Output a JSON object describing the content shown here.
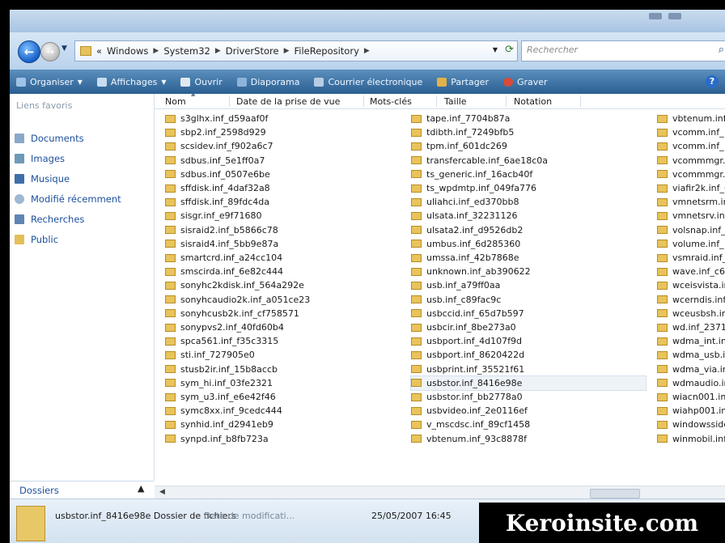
{
  "breadcrumb": {
    "overflow": "«",
    "segments": [
      "Windows",
      "System32",
      "DriverStore",
      "FileRepository"
    ]
  },
  "search": {
    "placeholder": "Rechercher"
  },
  "toolbar": {
    "organiser": "Organiser",
    "affichages": "Affichages",
    "ouvrir": "Ouvrir",
    "diaporama": "Diaporama",
    "courrier": "Courrier électronique",
    "partager": "Partager",
    "graver": "Graver"
  },
  "nav": {
    "header": "Liens favoris",
    "items": [
      "Documents",
      "Images",
      "Musique",
      "Modifié récemment",
      "Recherches",
      "Public"
    ],
    "dossiers": "Dossiers"
  },
  "columns": [
    "Nom",
    "Date de la prise de vue",
    "Mots-clés",
    "Taille",
    "Notation"
  ],
  "files": {
    "col1": [
      "s3glhx.inf_d59aaf0f",
      "sbp2.inf_2598d929",
      "scsidev.inf_f902a6c7",
      "sdbus.inf_5e1ff0a7",
      "sdbus.inf_0507e6be",
      "sffdisk.inf_4daf32a8",
      "sffdisk.inf_89fdc4da",
      "sisgr.inf_e9f71680",
      "sisraid2.inf_b5866c78",
      "sisraid4.inf_5bb9e87a",
      "smartcrd.inf_a24cc104",
      "smscirda.inf_6e82c444",
      "sonyhc2kdisk.inf_564a292e",
      "sonyhcaudio2k.inf_a051ce23",
      "sonyhcusb2k.inf_cf758571",
      "sonypvs2.inf_40fd60b4",
      "spca561.inf_f35c3315",
      "sti.inf_727905e0",
      "stusb2ir.inf_15b8accb",
      "sym_hi.inf_03fe2321",
      "sym_u3.inf_e6e42f46",
      "symc8xx.inf_9cedc444",
      "synhid.inf_d2941eb9",
      "synpd.inf_b8fb723a"
    ],
    "col2": [
      "tape.inf_7704b87a",
      "tdibth.inf_7249bfb5",
      "tpm.inf_601dc269",
      "transfercable.inf_6ae18c0a",
      "ts_generic.inf_16acb40f",
      "ts_wpdmtp.inf_049fa776",
      "uliahci.inf_ed370bb8",
      "ulsata.inf_32231126",
      "ulsata2.inf_d9526db2",
      "umbus.inf_6d285360",
      "umssa.inf_42b7868e",
      "unknown.inf_ab390622",
      "usb.inf_a79ff0aa",
      "usb.inf_c89fac9c",
      "usbccid.inf_65d7b597",
      "usbcir.inf_8be273a0",
      "usbport.inf_4d107f9d",
      "usbport.inf_8620422d",
      "usbprint.inf_35521f61",
      "usbstor.inf_8416e98e",
      "usbstor.inf_bb2778a0",
      "usbvideo.inf_2e0116ef",
      "v_mscdsc.inf_89cf1458",
      "vbtenum.inf_93c8878f"
    ],
    "col3": [
      "vbtenum.inf",
      "vcomm.inf_",
      "vcomm.inf_",
      "vcommmgr.",
      "vcommmgr.",
      "viafir2k.inf_6",
      "vmnetsrm.in",
      "vmnetsrv.inf",
      "volsnap.inf_",
      "volume.inf_",
      "vsmraid.inf_",
      "wave.inf_c65",
      "wceisvista.in",
      "wcerndis.inf",
      "wceusbsh.in",
      "wd.inf_2371f",
      "wdma_int.in",
      "wdma_usb.i",
      "wdma_via.in",
      "wdmaudio.ir",
      "wiacn001.inf",
      "wiahp001.inf",
      "windowsside",
      "winmobil.inf"
    ]
  },
  "status": {
    "name": "usbstor.inf_8416e98e Dossier de fichiers",
    "meta_label": "Date de modificati...",
    "date": "25/05/2007 16:45"
  },
  "watermark": "Keroinsite.com",
  "colors": {
    "toolbar": "#2b5f92",
    "link": "#1c4f9c",
    "folder": "#e9c35b"
  }
}
